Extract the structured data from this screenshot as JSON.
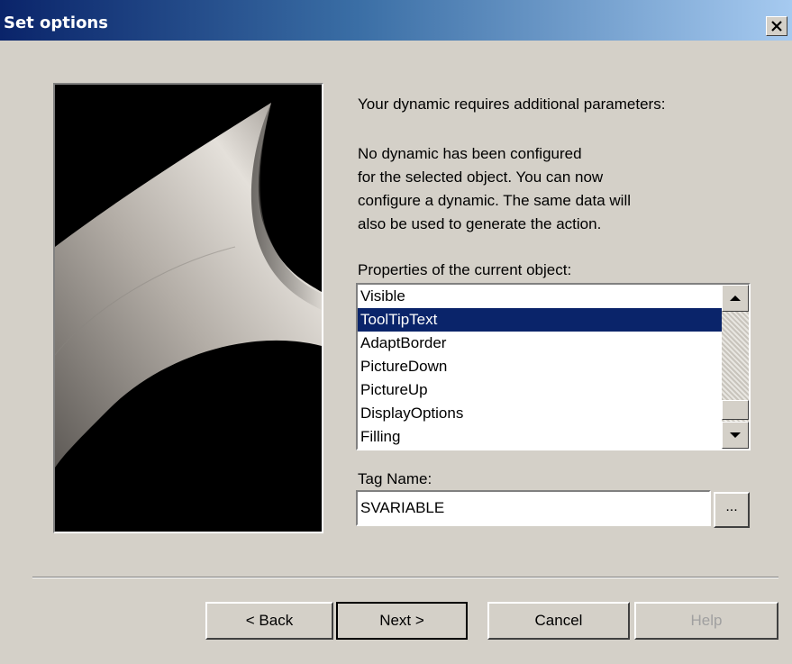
{
  "window": {
    "title": "Set options",
    "close_glyph": "✕"
  },
  "content": {
    "heading": "Your dynamic requires additional parameters:",
    "paragraph": "No dynamic has been configured\nfor the selected object. You can now\nconfigure a dynamic. The same data will\nalso be used to generate the action.",
    "properties_label": "Properties of the current object:",
    "properties": [
      {
        "label": "Visible",
        "selected": false
      },
      {
        "label": "ToolTipText",
        "selected": true
      },
      {
        "label": "AdaptBorder",
        "selected": false
      },
      {
        "label": "PictureDown",
        "selected": false
      },
      {
        "label": "PictureUp",
        "selected": false
      },
      {
        "label": "DisplayOptions",
        "selected": false
      },
      {
        "label": "Filling",
        "selected": false
      }
    ],
    "tag_label": "Tag Name:",
    "tag_value": "SVARIABLE",
    "browse_label": "..."
  },
  "buttons": {
    "back": "< Back",
    "next": "Next >",
    "cancel": "Cancel",
    "help": "Help",
    "help_enabled": false
  },
  "colors": {
    "title_gradient_start": "#0a246a",
    "title_gradient_end": "#a6caf0",
    "dialog_bg": "#d4d0c8",
    "selection_bg": "#0a246a"
  }
}
